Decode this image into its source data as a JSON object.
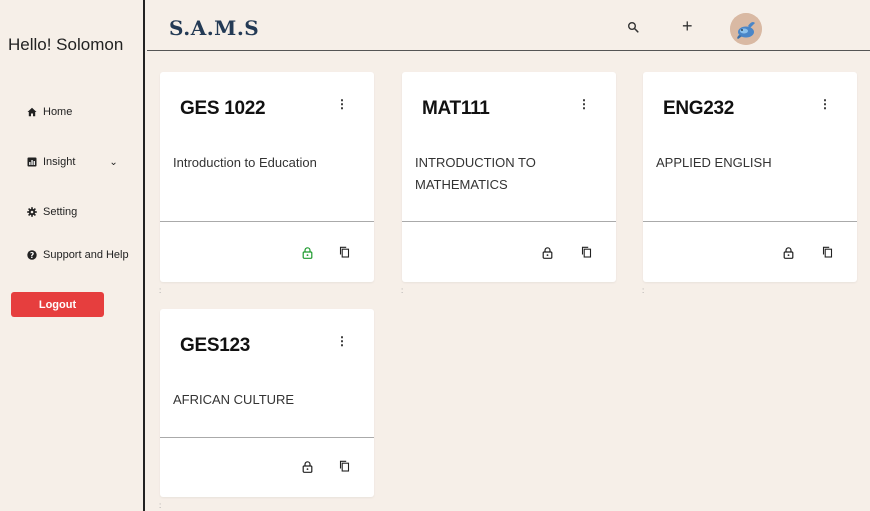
{
  "sidebar": {
    "greeting": "Hello! Solomon",
    "items": [
      {
        "label": "Home",
        "icon": "home-icon"
      },
      {
        "label": "Insight",
        "icon": "chart-icon"
      },
      {
        "label": "Setting",
        "icon": "gear-icon"
      },
      {
        "label": "Support and Help",
        "icon": "help-icon"
      }
    ],
    "logout_label": "Logout"
  },
  "header": {
    "brand": "S.A.M.S",
    "icons": [
      "search-icon",
      "plus-icon",
      "avatar"
    ]
  },
  "courses": [
    {
      "code": "GES 1022",
      "title": "Introduction to Education",
      "lock_color": "#1e9a2e"
    },
    {
      "code": "MAT111",
      "title": "INTRODUCTION TO MATHEMATICS",
      "lock_color": "#222222"
    },
    {
      "code": "ENG232",
      "title": "APPLIED ENGLISH",
      "lock_color": "#222222"
    },
    {
      "code": "GES123",
      "title": "AFRICAN CULTURE",
      "lock_color": "#222222"
    }
  ],
  "colors": {
    "background": "#f6efe8",
    "brand": "#233a55",
    "logout": "#e63e3e"
  }
}
